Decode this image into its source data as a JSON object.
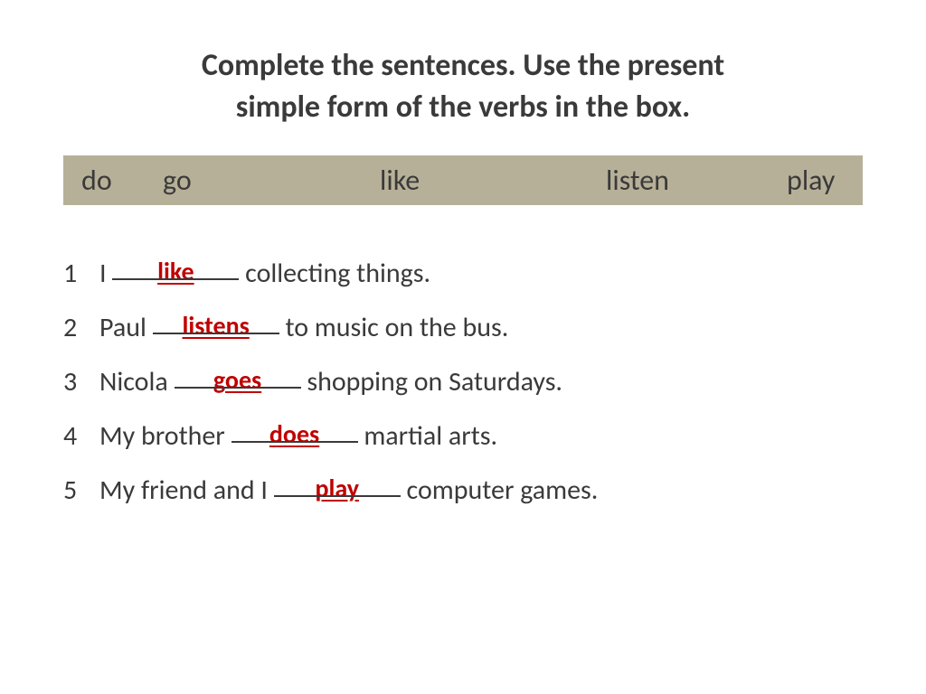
{
  "title_line1": "Complete the sentences. Use the present",
  "title_line2": "simple form of  the verbs in the box.",
  "verbs": {
    "v1": "do",
    "v2": "go",
    "v3": "like",
    "v4": "listen",
    "v5": "play"
  },
  "sentences": [
    {
      "num": "1",
      "before": "I ",
      "answer": "like",
      "after": " collecting things."
    },
    {
      "num": "2",
      "before": "Paul ",
      "answer": "listens",
      "after": " to music on the bus."
    },
    {
      "num": "3",
      "before": "Nicola ",
      "answer": "goes",
      "after": " shopping on Saturdays."
    },
    {
      "num": "4",
      "before": "My brother ",
      "answer": "does",
      "after": " martial arts."
    },
    {
      "num": "5",
      "before": "My friend and I ",
      "answer": "play",
      "after": " computer games."
    }
  ]
}
